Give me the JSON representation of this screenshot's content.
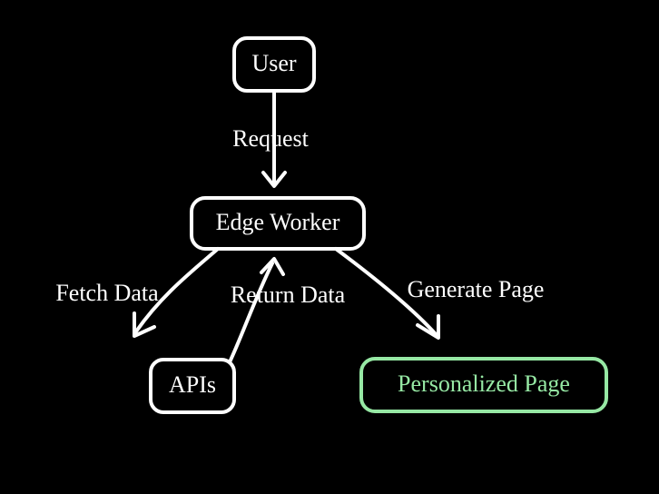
{
  "nodes": {
    "user": {
      "label": "User"
    },
    "edge_worker": {
      "label": "Edge Worker"
    },
    "apis": {
      "label": "APIs"
    },
    "personalized_page": {
      "label": "Personalized Page"
    }
  },
  "edges": {
    "request": {
      "label": "Request"
    },
    "fetch_data": {
      "label": "Fetch Data"
    },
    "return_data": {
      "label": "Return Data"
    },
    "generate_page": {
      "label": "Generate Page"
    }
  }
}
